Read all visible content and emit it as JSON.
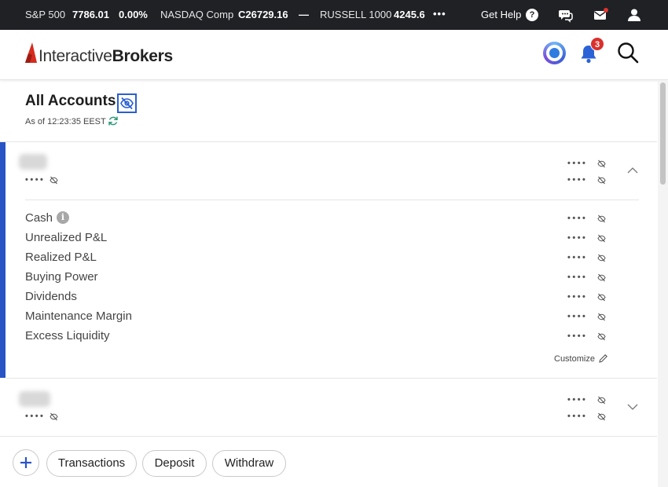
{
  "ticker": {
    "items": [
      {
        "name": "S&P 500",
        "value": "7786.01",
        "change": "0.00%"
      },
      {
        "name": "NASDAQ Comp",
        "value": "C26729.16",
        "change": "—"
      },
      {
        "name": "RUSSELL 1000",
        "value": "4245.6",
        "change": ""
      }
    ],
    "more": "•••",
    "help_label": "Get Help",
    "help_icon": "?"
  },
  "header": {
    "logo_light": "Interactive",
    "logo_bold": "Brokers",
    "notification_count": "3",
    "colors": {
      "brand_red": "#d52b1e",
      "accent_blue": "#2854c5",
      "bell_blue": "#2b63d6"
    }
  },
  "accounts": {
    "title": "All Accounts",
    "as_of": "As of 12:23:35 EEST",
    "masked": "••••",
    "rows": [
      {
        "label": "Cash",
        "value": "••••",
        "info": "i"
      },
      {
        "label": "Unrealized P&L",
        "value": "••••"
      },
      {
        "label": "Realized P&L",
        "value": "••••"
      },
      {
        "label": "Buying Power",
        "value": "••••"
      },
      {
        "label": "Dividends",
        "value": "••••"
      },
      {
        "label": "Maintenance Margin",
        "value": "••••"
      },
      {
        "label": "Excess Liquidity",
        "value": "••••"
      }
    ],
    "customize": "Customize"
  },
  "actions": {
    "add": "+",
    "buttons": [
      "Transactions",
      "Deposit",
      "Withdraw"
    ]
  }
}
